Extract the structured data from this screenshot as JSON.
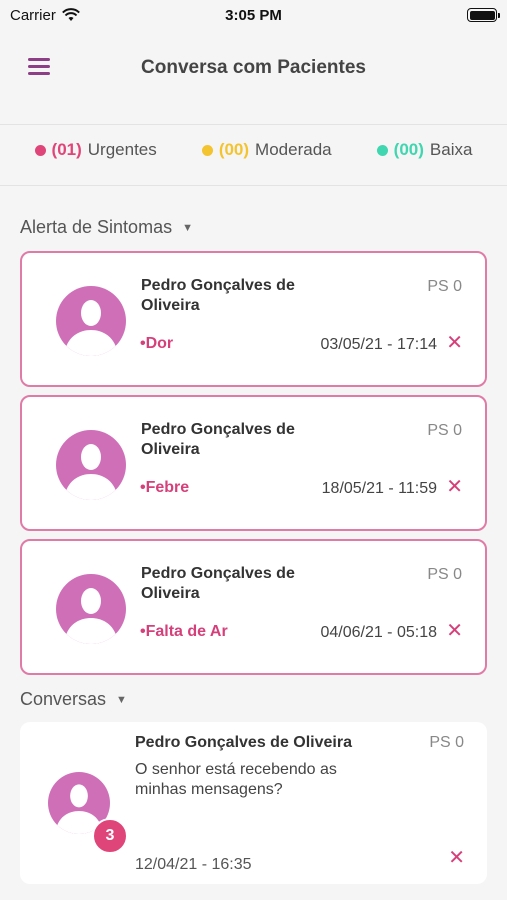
{
  "status_bar": {
    "carrier": "Carrier",
    "time": "3:05 PM"
  },
  "header": {
    "title": "Conversa com Pacientes"
  },
  "legend": [
    {
      "count": "(01)",
      "label": "Urgentes",
      "color": "#e0457a"
    },
    {
      "count": "(00)",
      "label": "Moderada",
      "color": "#f4c430"
    },
    {
      "count": "(00)",
      "label": "Baixa",
      "color": "#3fd6b0"
    }
  ],
  "alerts_section": {
    "title": "Alerta de Sintomas"
  },
  "alerts": [
    {
      "name": "Pedro Gonçalves de Oliveira",
      "ps": "PS 0",
      "symptom": "•Dor",
      "date": "03/05/21 - 17:14"
    },
    {
      "name": "Pedro Gonçalves de Oliveira",
      "ps": "PS 0",
      "symptom": "•Febre",
      "date": "18/05/21 - 11:59"
    },
    {
      "name": "Pedro Gonçalves de Oliveira",
      "ps": "PS 0",
      "symptom": "•Falta de Ar",
      "date": "04/06/21 - 05:18"
    }
  ],
  "chats_section": {
    "title": "Conversas"
  },
  "chats": [
    {
      "name": "Pedro Gonçalves de Oliveira",
      "ps": "PS 0",
      "message": "O senhor está recebendo as minhas mensagens?",
      "date": "12/04/21 - 16:35",
      "unread": "3"
    }
  ],
  "icons": {
    "menu": "hamburger-icon",
    "close": "close-x-icon",
    "caret": "caret-down-icon",
    "avatar": "person-silhouette-icon"
  },
  "colors": {
    "accent": "#8e3e86",
    "urgent": "#e0457a",
    "avatar_bg": "#cf6fb8",
    "card_border": "#e07aa6"
  }
}
